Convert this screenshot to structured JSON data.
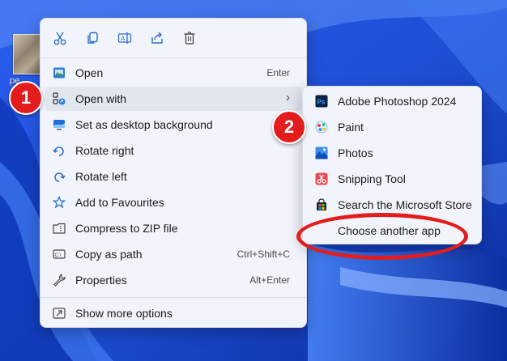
{
  "desktop": {
    "icon_label": "pe...",
    "wallpaper_colors": [
      "#1e4fd6",
      "#2d6cf0",
      "#0a2a9a"
    ]
  },
  "toolbar": {
    "icons": [
      "cut-icon",
      "copy-icon",
      "rename-icon",
      "share-icon",
      "delete-icon"
    ]
  },
  "menu": {
    "items": [
      {
        "label": "Open",
        "shortcut": "Enter",
        "icon": "open-icon"
      },
      {
        "label": "Open with",
        "shortcut": "",
        "icon": "open-with-icon",
        "has_submenu": true,
        "active": true
      },
      {
        "label": "Set as desktop background",
        "shortcut": "",
        "icon": "desktop-background-icon"
      },
      {
        "label": "Rotate right",
        "shortcut": "",
        "icon": "rotate-right-icon"
      },
      {
        "label": "Rotate left",
        "shortcut": "",
        "icon": "rotate-left-icon"
      },
      {
        "label": "Add to Favourites",
        "shortcut": "",
        "icon": "star-icon"
      },
      {
        "label": "Compress to ZIP file",
        "shortcut": "",
        "icon": "zip-icon"
      },
      {
        "label": "Copy as path",
        "shortcut": "Ctrl+Shift+C",
        "icon": "copy-path-icon"
      },
      {
        "label": "Properties",
        "shortcut": "Alt+Enter",
        "icon": "wrench-icon"
      }
    ],
    "more_options": {
      "label": "Show more options",
      "icon": "show-more-icon"
    },
    "submenu_arrow": "›"
  },
  "submenu": {
    "items": [
      {
        "label": "Adobe Photoshop 2024",
        "icon": "photoshop-icon"
      },
      {
        "label": "Paint",
        "icon": "paint-icon"
      },
      {
        "label": "Photos",
        "icon": "photos-icon"
      },
      {
        "label": "Snipping Tool",
        "icon": "snipping-tool-icon"
      },
      {
        "label": "Search the Microsoft Store",
        "icon": "store-icon"
      },
      {
        "label": "Choose another app",
        "icon": ""
      }
    ]
  },
  "annotations": {
    "step1": "1",
    "step2": "2",
    "color": "#e31d1d"
  }
}
